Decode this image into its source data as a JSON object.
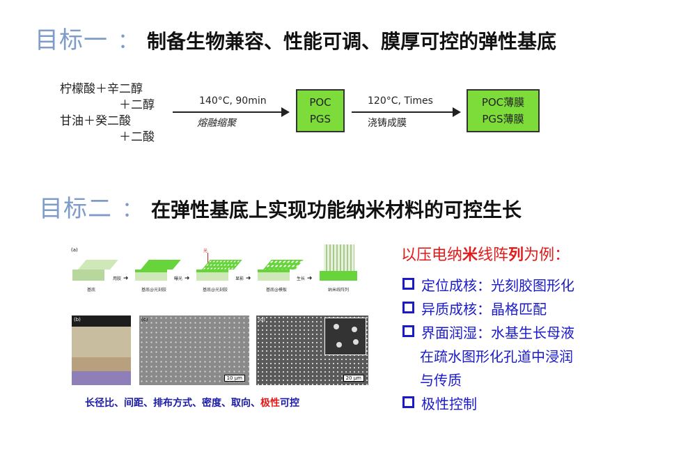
{
  "goal1": {
    "label": "目标一",
    "colon": "：",
    "text": "制备生物兼容、性能可调、膜厚可控的弹性基底"
  },
  "reaction": {
    "reactant_line1": "柠檬酸＋辛二醇",
    "reactant_line2": "＋二醇",
    "reactant_line3": "甘油＋癸二酸",
    "reactant_line4": "＋二酸",
    "step1_condition": "140°C, 90min",
    "step1_process": "熔融缩聚",
    "polymer_box": [
      "POC",
      "PGS"
    ],
    "step2_condition": "120°C, Times",
    "step2_process": "浇铸成膜",
    "film_box": [
      "POC薄膜",
      "PGS薄膜"
    ]
  },
  "goal2": {
    "label": "目标二",
    "colon": "：",
    "text": "在弹性基底上实现功能纳米材料的可控生长"
  },
  "figure": {
    "panel_a": "(a)",
    "panel_b": "(b)",
    "panel_c": "(c)",
    "panel_d": "(d)",
    "step_captions": [
      "基底",
      "基底@光刻胶",
      "基底@光刻胶",
      "基底@模板",
      "纳米线阵列"
    ],
    "arrow_labels": [
      "用胶",
      "曝光",
      "显影",
      "生长"
    ],
    "light_label": "光",
    "scale_c": "10 μm",
    "scale_d": "20 μm",
    "caption_blue": "长径比、间距、排布方式、密度、取向、",
    "caption_red": "极性",
    "caption_tail": "可控",
    "colors": {
      "substrate_top": "#cfe8b8",
      "substrate_front": "#b7d79c",
      "resist": "#66d43a",
      "caption_blue": "#1a1aa8",
      "caption_red": "#e31a1a"
    }
  },
  "right": {
    "title_part1": "以压电纳",
    "title_emph": "米",
    "title_part2": "线阵",
    "title_emph2": "列",
    "title_part3": "为例：",
    "bullets": [
      {
        "text": "定位成核：光刻胶图形化"
      },
      {
        "text": "异质成核：晶格匹配"
      },
      {
        "text": "界面润湿：水基生长母液"
      },
      {
        "text": "极性控制"
      }
    ],
    "bullet3_cont1": "在疏水图形化孔道中浸润",
    "bullet3_cont2": "与传质"
  }
}
